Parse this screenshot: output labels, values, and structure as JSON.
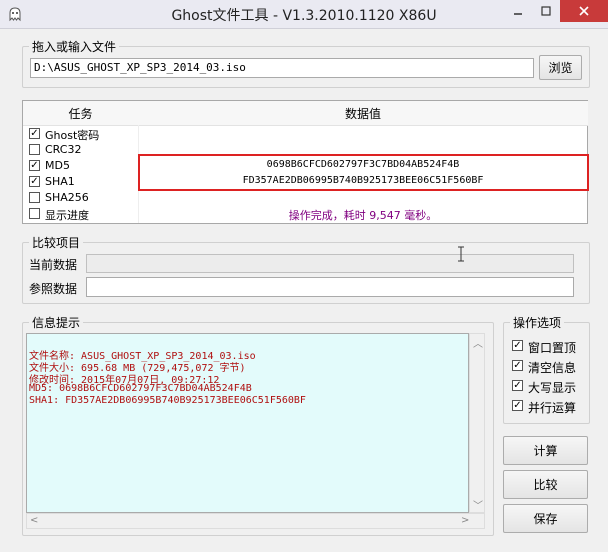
{
  "window": {
    "title": "Ghost文件工具 - V1.3.2010.1120 X86U"
  },
  "input_group": {
    "title": "拖入或输入文件",
    "path": "D:\\ASUS_GHOST_XP_SP3_2014_03.iso",
    "browse_label": "浏览"
  },
  "task_table": {
    "col_task": "任务",
    "col_data": "数据值",
    "rows": [
      {
        "name": "Ghost密码",
        "checked": true,
        "value": ""
      },
      {
        "name": "CRC32",
        "checked": false,
        "value": ""
      },
      {
        "name": "MD5",
        "checked": true,
        "value": "0698B6CFCD602797F3C7BD04AB524F4B"
      },
      {
        "name": "SHA1",
        "checked": true,
        "value": "FD357AE2DB06995B740B925173BEE06C51F560BF"
      },
      {
        "name": "SHA256",
        "checked": false,
        "value": ""
      },
      {
        "name": "显示进度",
        "checked": false,
        "value": "操作完成，耗时 9,547 毫秒。"
      }
    ]
  },
  "compare_group": {
    "title": "比较项目",
    "current_label": "当前数据",
    "current_value": "",
    "ref_label": "参照数据",
    "ref_value": ""
  },
  "info_group": {
    "title": "信息提示",
    "lines": [
      "文件名称: ASUS_GHOST_XP_SP3_2014_03.iso",
      "文件大小: 695.68 MB (729,475,072 字节)",
      "修改时间: 2015年07月07日, 09:27:12",
      "MD5: 0698B6CFCD602797F3C7BD04AB524F4B",
      "SHA1: FD357AE2DB06995B740B925173BEE06C51F560BF"
    ]
  },
  "options_group": {
    "title": "操作选项",
    "items": [
      {
        "label": "窗口置顶",
        "checked": true
      },
      {
        "label": "清空信息",
        "checked": true
      },
      {
        "label": "大写显示",
        "checked": true
      },
      {
        "label": "并行运算",
        "checked": true
      }
    ]
  },
  "buttons": {
    "calc": "计算",
    "compare": "比较",
    "save": "保存"
  },
  "colors": {
    "highlight_border": "#d22222",
    "info_text": "#b01010",
    "info_bg": "#e3fbfb",
    "status_text": "#800080"
  }
}
